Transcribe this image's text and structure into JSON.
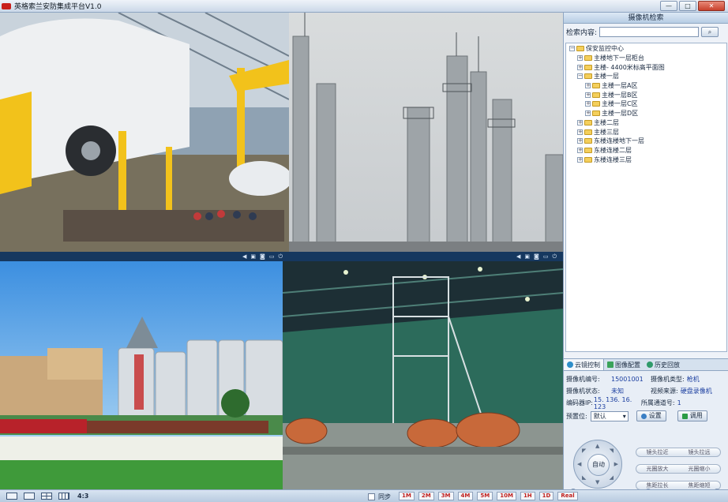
{
  "window": {
    "title": "英格索兰安防集成平台V1.0",
    "min_label": "—",
    "max_label": "□",
    "close_label": "✕"
  },
  "panes": [
    {
      "id": "view-1",
      "scene": "automotive-assembly-line"
    },
    {
      "id": "view-2",
      "scene": "refinery-towers"
    },
    {
      "id": "view-3",
      "scene": "grain-silos-train"
    },
    {
      "id": "view-4",
      "scene": "wire-coil-factory"
    }
  ],
  "pane_controls": [
    "speaker-icon",
    "record-icon",
    "snapshot-icon",
    "window-icon",
    "power-icon"
  ],
  "pane_control_glyphs": [
    "◀",
    "▣",
    "◙",
    "▭",
    "⏻"
  ],
  "sidebar": {
    "header": "摄像机检索",
    "search_label": "检索内容:",
    "search_value": "",
    "search_placeholder": "",
    "search_button": "⌕"
  },
  "tree": [
    {
      "label": "保安监控中心",
      "level": 0,
      "toggle": "−"
    },
    {
      "label": "主楼地下一层柜台",
      "level": 1,
      "toggle": "+"
    },
    {
      "label": "主楼- 4400米标高平面图",
      "level": 1,
      "toggle": "+"
    },
    {
      "label": "主楼一层",
      "level": 1,
      "toggle": "−"
    },
    {
      "label": "主楼一层A区",
      "level": 2,
      "toggle": "+"
    },
    {
      "label": "主楼一层B区",
      "level": 2,
      "toggle": "+"
    },
    {
      "label": "主楼一层C区",
      "level": 2,
      "toggle": "+"
    },
    {
      "label": "主楼一层D区",
      "level": 2,
      "toggle": "+"
    },
    {
      "label": "主楼二层",
      "level": 1,
      "toggle": "+"
    },
    {
      "label": "主楼三层",
      "level": 1,
      "toggle": "+"
    },
    {
      "label": "东楼连楼地下一层",
      "level": 1,
      "toggle": "+"
    },
    {
      "label": "东楼连楼二层",
      "level": 1,
      "toggle": "+"
    },
    {
      "label": "东楼连楼三层",
      "level": 1,
      "toggle": "+"
    }
  ],
  "control": {
    "tabs": [
      "云镜控制",
      "图像配置",
      "历史回放"
    ],
    "camera_id_label": "摄像机编号:",
    "camera_id": "15001001",
    "camera_type_label": "摄像机类型:",
    "camera_type": "枪机",
    "camera_status_label": "摄像机状态:",
    "camera_status": "未知",
    "video_source_label": "视频来源:",
    "video_source": "硬盘录像机",
    "encoder_ip_label": "编码器IP:",
    "encoder_ip": "15. 136. 16. 123",
    "channel_label": "所属通道号:",
    "channel": "1",
    "preset_label": "预置位:",
    "preset_value": "默认",
    "set_button": "设置",
    "call_button": "调用",
    "auto_label": "自动",
    "zoom_near": "镜头拉近",
    "zoom_far": "镜头拉远",
    "iris_open": "光圈放大",
    "iris_close": "光圈缩小",
    "focus_near": "焦距拉长",
    "focus_far": "焦距缩短",
    "slider_minus": "−",
    "slider_plus": "+"
  },
  "statusbar": {
    "aspect": "4:3",
    "sync_label": "同步",
    "rates": [
      "1M",
      "2M",
      "3M",
      "4M",
      "5M",
      "10M",
      "1H",
      "1D",
      "Real"
    ]
  },
  "colors": {
    "pane_bar": "#16385f",
    "accent": "#c0221f",
    "panel": "#eef2f8"
  }
}
